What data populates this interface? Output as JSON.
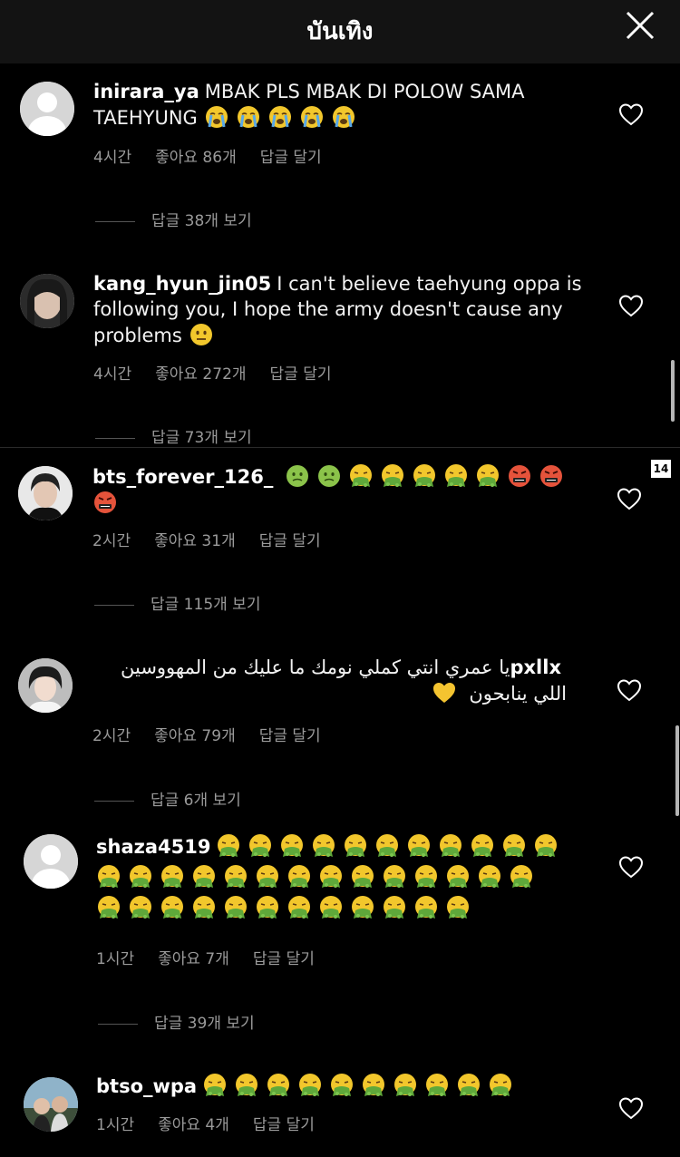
{
  "header": {
    "title": "บันเทิง",
    "close_icon": "close-icon"
  },
  "page_badge": "14",
  "comments": [
    {
      "username": "inirara_ya",
      "text": "MBAK PLS MBAK DI POLOW SAMA TAEHYUNG",
      "emojis": [
        "loudly-crying",
        "loudly-crying",
        "loudly-crying",
        "loudly-crying",
        "loudly-crying"
      ],
      "time": "4시간",
      "likes": "좋아요 86개",
      "reply": "답글 달기",
      "view_replies": "답글 38개 보기",
      "avatar": "default-avatar"
    },
    {
      "username": "kang_hyun_jin05",
      "text": "I can't believe taehyung oppa is following you, I hope the army doesn't cause any problems",
      "emojis": [
        "neutral-face"
      ],
      "time": "4시간",
      "likes": "좋아요 272개",
      "reply": "답글 달기",
      "view_replies": "답글 73개 보기",
      "avatar": "photo-avatar"
    },
    {
      "username": "bts_forever_126_",
      "text": "",
      "emojis": [
        "nauseated",
        "nauseated",
        "vomiting",
        "vomiting",
        "vomiting",
        "vomiting",
        "vomiting",
        "swearing",
        "swearing",
        "swearing"
      ],
      "time": "2시간",
      "likes": "좋아요 31개",
      "reply": "답글 달기",
      "view_replies": "답글 115개 보기",
      "avatar": "photo-avatar"
    },
    {
      "username": "pxllx",
      "text": "يا عمري انتي كملي نومك ما عليك من المهووسين اللي ينابحون",
      "emojis": [
        "yellow-heart"
      ],
      "time": "2시간",
      "likes": "좋아요 79개",
      "reply": "답글 달기",
      "view_replies": "답글 6개 보기",
      "avatar": "photo-avatar"
    },
    {
      "username": "shaza4519",
      "text": "",
      "emoji_count": 37,
      "emoji": "vomiting",
      "time": "1시간",
      "likes": "좋아요 7개",
      "reply": "답글 달기",
      "view_replies": "답글 39개 보기",
      "avatar": "default-avatar"
    },
    {
      "username": "btso_wpa",
      "text": "",
      "emoji_count": 10,
      "emoji": "vomiting",
      "time": "1시간",
      "likes": "좋아요 4개",
      "reply": "답글 달기",
      "avatar": "photo-avatar"
    }
  ],
  "colors": {
    "background": "#000000",
    "header_bg": "#131313",
    "meta_text": "#9a9a9a",
    "vomit_face": "#f2c72c",
    "vomit": "#5fa83a"
  }
}
